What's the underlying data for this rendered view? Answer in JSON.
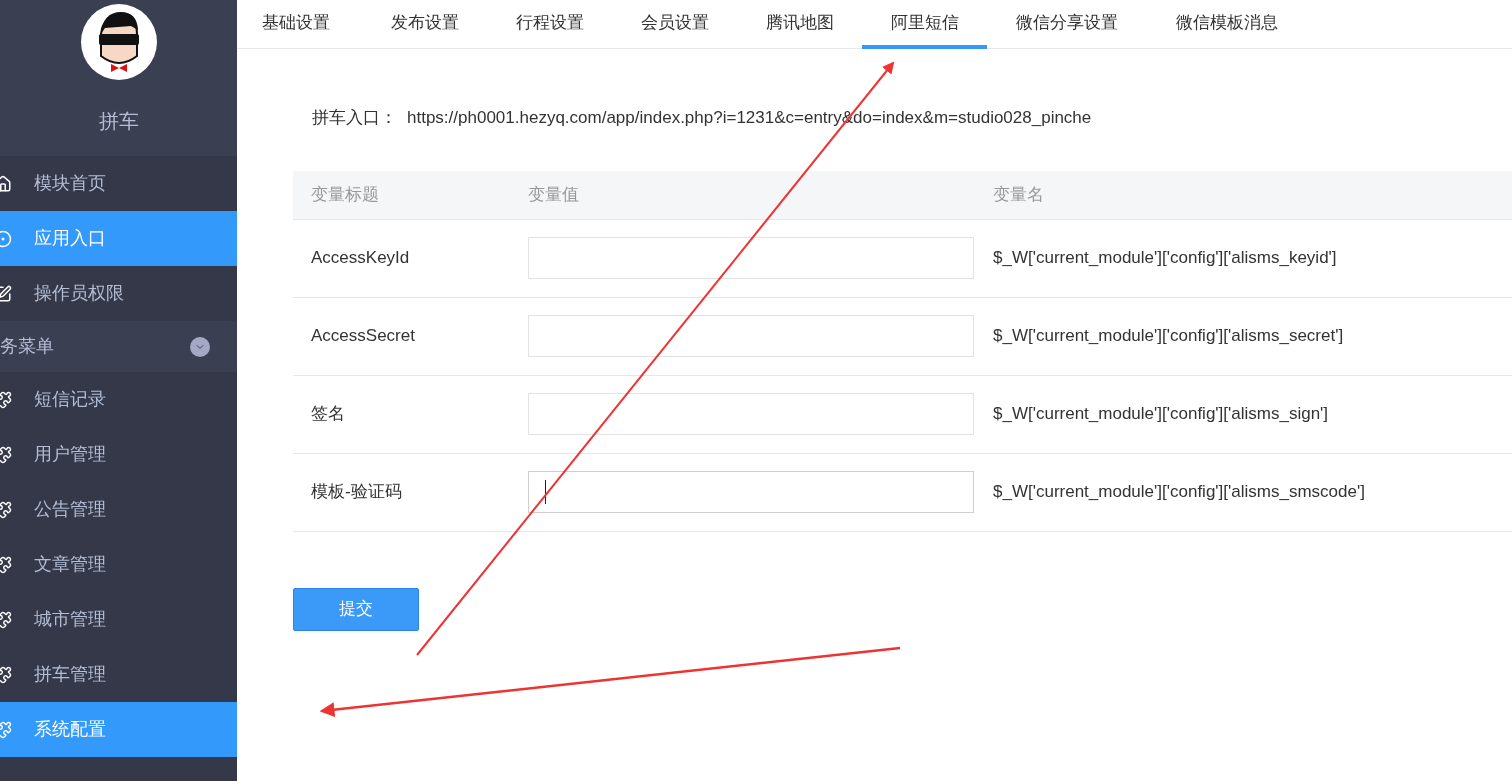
{
  "sidebar": {
    "title": "拼车",
    "items": [
      {
        "label": "模块首页",
        "selected": false
      },
      {
        "label": "应用入口",
        "selected": true
      },
      {
        "label": "操作员权限",
        "selected": false
      }
    ],
    "group": {
      "label": "务菜单",
      "expanded": true,
      "children": [
        {
          "label": "短信记录",
          "selected": false
        },
        {
          "label": "用户管理",
          "selected": false
        },
        {
          "label": "公告管理",
          "selected": false
        },
        {
          "label": "文章管理",
          "selected": false
        },
        {
          "label": "城市管理",
          "selected": false
        },
        {
          "label": "拼车管理",
          "selected": false
        },
        {
          "label": "系统配置",
          "selected": true
        }
      ]
    }
  },
  "tabs": [
    {
      "label": "基础设置",
      "selected": false
    },
    {
      "label": "发布设置",
      "selected": false
    },
    {
      "label": "行程设置",
      "selected": false
    },
    {
      "label": "会员设置",
      "selected": false
    },
    {
      "label": "腾讯地图",
      "selected": false
    },
    {
      "label": "阿里短信",
      "selected": true
    },
    {
      "label": "微信分享设置",
      "selected": false
    },
    {
      "label": "微信模板消息",
      "selected": false
    }
  ],
  "entry": {
    "label": "拼车入口：",
    "url": "https://ph0001.hezyq.com/app/index.php?i=1231&c=entry&do=index&m=studio028_pinche"
  },
  "table": {
    "columns": [
      "变量标题",
      "变量值",
      "变量名"
    ],
    "rows": [
      {
        "title": "AccessKeyId",
        "focused": false,
        "name": "$_W['current_module']['config']['alisms_keyid']"
      },
      {
        "title": "AccessSecret",
        "focused": false,
        "name": "$_W['current_module']['config']['alisms_secret']"
      },
      {
        "title": "签名",
        "focused": false,
        "name": "$_W['current_module']['config']['alisms_sign']"
      },
      {
        "title": "模板-验证码",
        "focused": true,
        "name": "$_W['current_module']['config']['alisms_smscode']"
      }
    ]
  },
  "submit": "提交"
}
